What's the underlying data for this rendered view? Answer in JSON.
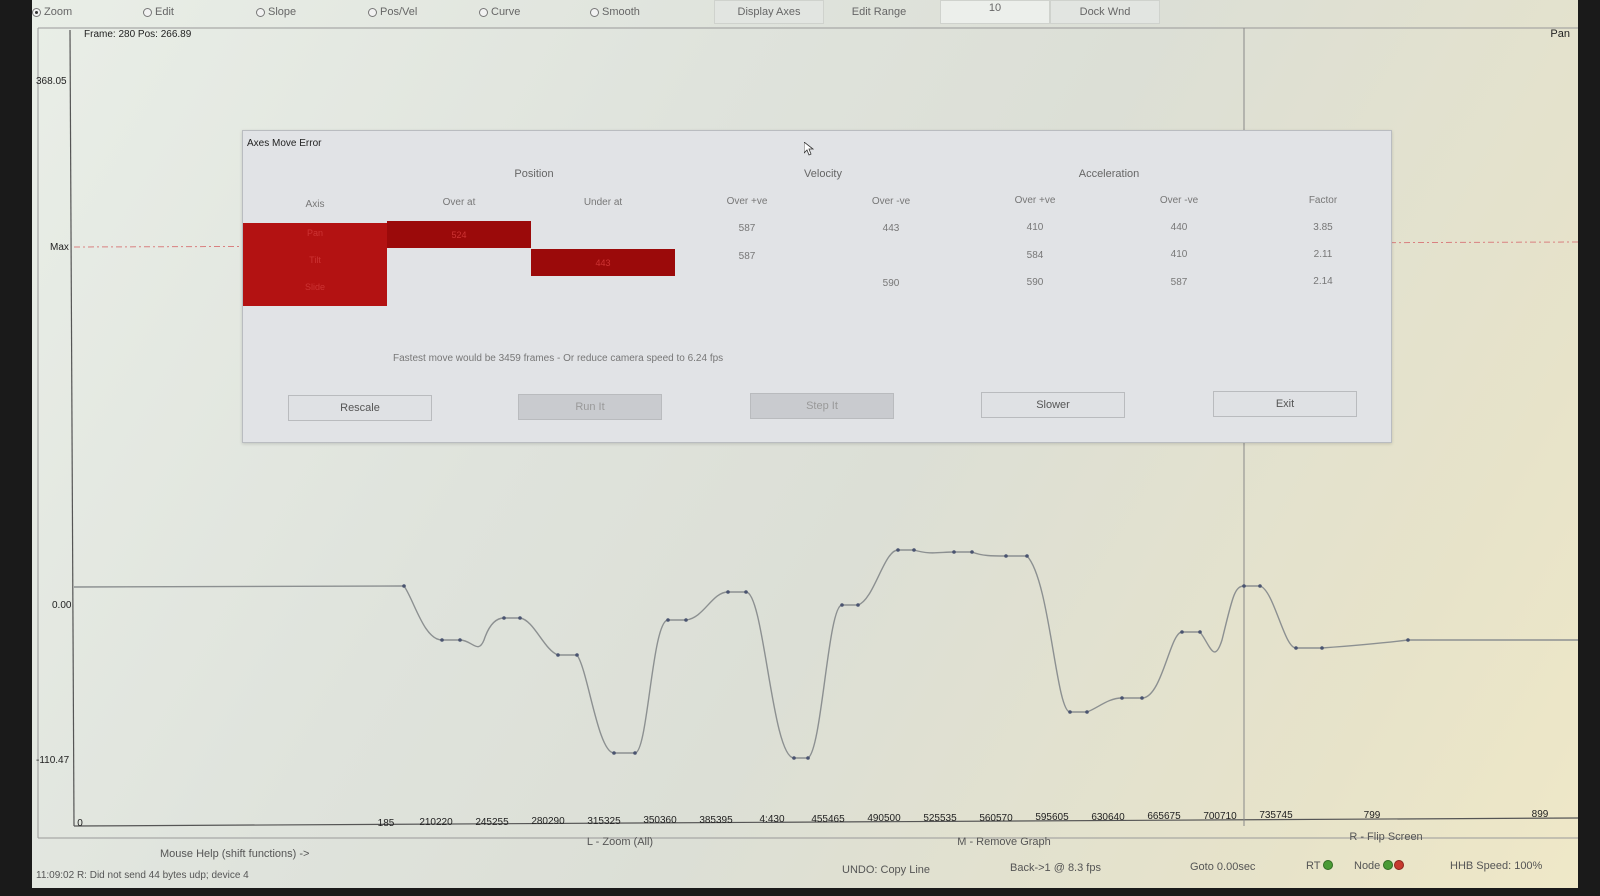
{
  "toolbar": {
    "modes": [
      {
        "label": "Zoom",
        "selected": true
      },
      {
        "label": "Edit",
        "selected": false
      },
      {
        "label": "Slope",
        "selected": false
      },
      {
        "label": "Pos/Vel",
        "selected": false
      },
      {
        "label": "Curve",
        "selected": false
      },
      {
        "label": "Smooth",
        "selected": false
      }
    ],
    "display_axes": "Display Axes",
    "edit_range": "Edit Range",
    "range_value": "10",
    "dock_wnd": "Dock Wnd"
  },
  "graph": {
    "frame_info": "Frame:  280   Pos: 266.89",
    "pan_label": "Pan",
    "y_labels": {
      "top": "368.05",
      "max": "Max",
      "zero": "0.00",
      "bottom": "-110.47"
    },
    "x_ticks": [
      "0",
      "185",
      "210220",
      "245255",
      "280290",
      "315325",
      "350360",
      "385395",
      "4:430",
      "455465",
      "490500",
      "525535",
      "560570",
      "595605",
      "630640",
      "665675",
      "700710",
      "735745",
      "799",
      "899"
    ],
    "x_help": {
      "left": "L - Zoom (All)",
      "middle": "M - Remove Graph",
      "right": "R - Flip Screen"
    },
    "colors": {
      "curve": "#8c9091",
      "max_line": "#e06a6a",
      "axis": "#555555"
    }
  },
  "dialog": {
    "title": "Axes Move Error",
    "groups": {
      "position": "Position",
      "velocity": "Velocity",
      "acceleration": "Acceleration"
    },
    "columns": [
      "Axis",
      "Over at",
      "Under at",
      "Over +ve",
      "Over -ve",
      "Over +ve",
      "Over -ve",
      "Factor"
    ],
    "rows": [
      {
        "axis": "Pan",
        "over_at": "524",
        "under_at": "",
        "vel_pos": "587",
        "vel_neg": "443",
        "acc_pos": "410",
        "acc_neg": "440",
        "factor": "3.85"
      },
      {
        "axis": "Tilt",
        "over_at": "",
        "under_at": "443",
        "vel_pos": "587",
        "vel_neg": "",
        "acc_pos": "584",
        "acc_neg": "410",
        "factor": "2.11"
      },
      {
        "axis": "Slide",
        "over_at": "",
        "under_at": "",
        "vel_pos": "",
        "vel_neg": "590",
        "acc_pos": "590",
        "acc_neg": "587",
        "factor": "2.14"
      }
    ],
    "fastest_text": "Fastest move would be  3459 frames   - Or reduce camera speed to 6.24 fps",
    "buttons": {
      "rescale": "Rescale",
      "run_it": "Run It",
      "step_it": "Step It",
      "slower": "Slower",
      "exit": "Exit"
    },
    "error_color": "#b31212"
  },
  "status": {
    "mouse_help": "Mouse Help (shift functions) ->",
    "log": "11:09:02  R: Did not send 44 bytes udp; device 4",
    "undo": "UNDO: Copy Line",
    "back": "Back->1 @ 8.3 fps",
    "goto": "Goto 0.00sec",
    "rt": "RT",
    "node": "Node",
    "speed": "HHB Speed: 100%"
  }
}
